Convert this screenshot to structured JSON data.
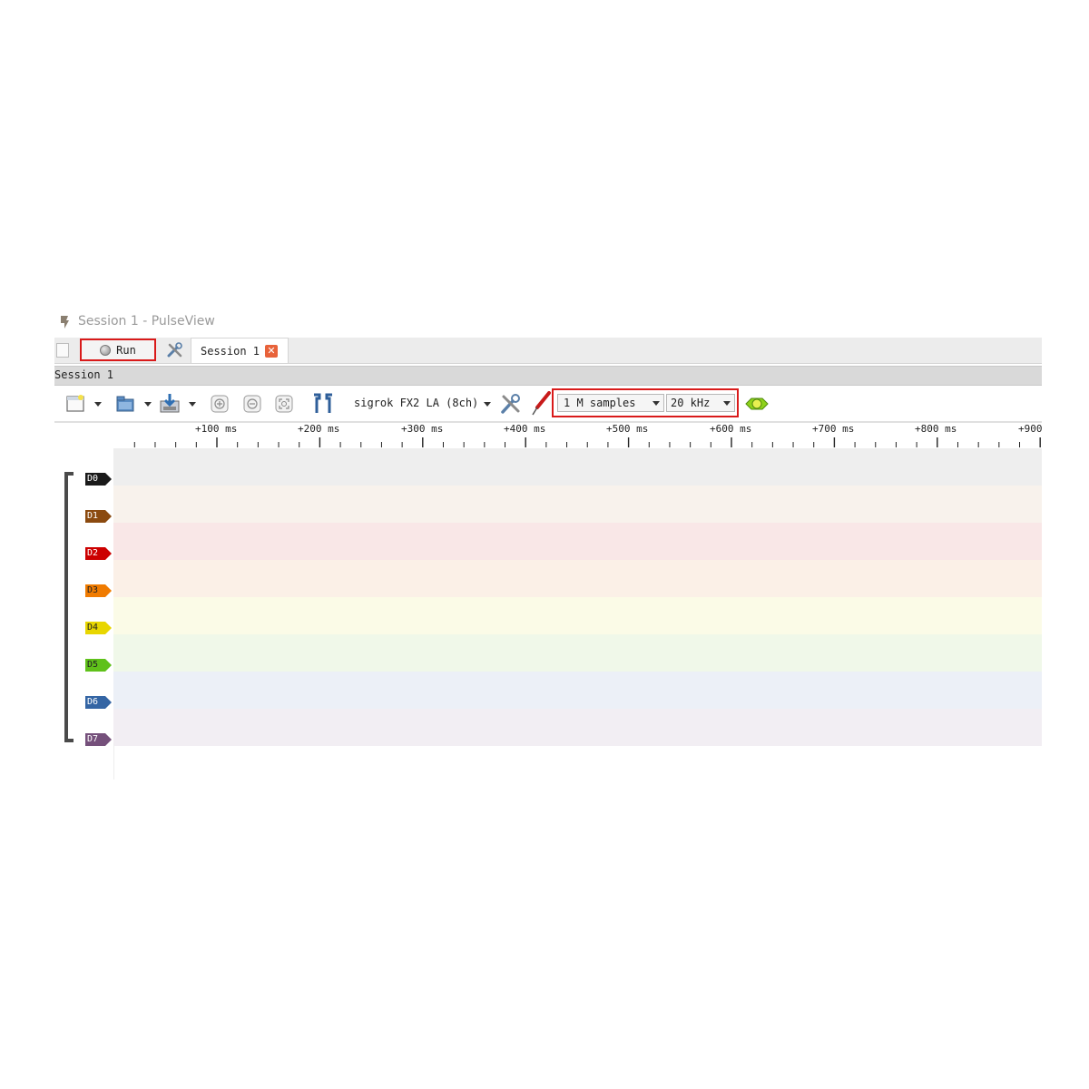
{
  "window": {
    "title": "Session 1 - PulseView"
  },
  "tabbar": {
    "run_label": "Run",
    "session_tab_label": "Session 1",
    "close_glyph": "✕"
  },
  "session_strip": {
    "label": "Session 1"
  },
  "toolbar": {
    "device": "sigrok FX2 LA (8ch)",
    "samples": "1 M samples",
    "samplerate": "20 kHz"
  },
  "ruler": {
    "ticks": [
      "+100 ms",
      "+200 ms",
      "+300 ms",
      "+400 ms",
      "+500 ms",
      "+600 ms",
      "+700 ms",
      "+800 ms",
      "+900"
    ]
  },
  "channels": [
    {
      "name": "D0",
      "color": "#1a1a1a",
      "text_color": "#ffffff",
      "row_bg": "#eeeeee"
    },
    {
      "name": "D1",
      "color": "#8b4a0f",
      "text_color": "#ffffff",
      "row_bg": "#f8f2ec"
    },
    {
      "name": "D2",
      "color": "#cc0000",
      "text_color": "#ffffff",
      "row_bg": "#f9e7e7"
    },
    {
      "name": "D3",
      "color": "#f07b00",
      "text_color": "#222222",
      "row_bg": "#fbf0e7"
    },
    {
      "name": "D4",
      "color": "#e8d600",
      "text_color": "#222222",
      "row_bg": "#fbfbe7"
    },
    {
      "name": "D5",
      "color": "#5fc11a",
      "text_color": "#222222",
      "row_bg": "#f0f8e9"
    },
    {
      "name": "D6",
      "color": "#3465a4",
      "text_color": "#ffffff",
      "row_bg": "#ecf0f7"
    },
    {
      "name": "D7",
      "color": "#75507b",
      "text_color": "#ffffff",
      "row_bg": "#f2eef3"
    }
  ],
  "icons": {
    "app": "pulseview-logo-icon",
    "settings": "tools-icon",
    "new_session": "new-session-icon",
    "open": "open-folder-icon",
    "save": "save-icon",
    "zoom_in": "zoom-in-icon",
    "zoom_out": "zoom-out-icon",
    "zoom_fit": "zoom-fit-icon",
    "cursors": "cursor-markers-icon",
    "device_config": "device-config-icon",
    "probe": "probe-icon",
    "decoder": "protocol-decoder-icon"
  }
}
